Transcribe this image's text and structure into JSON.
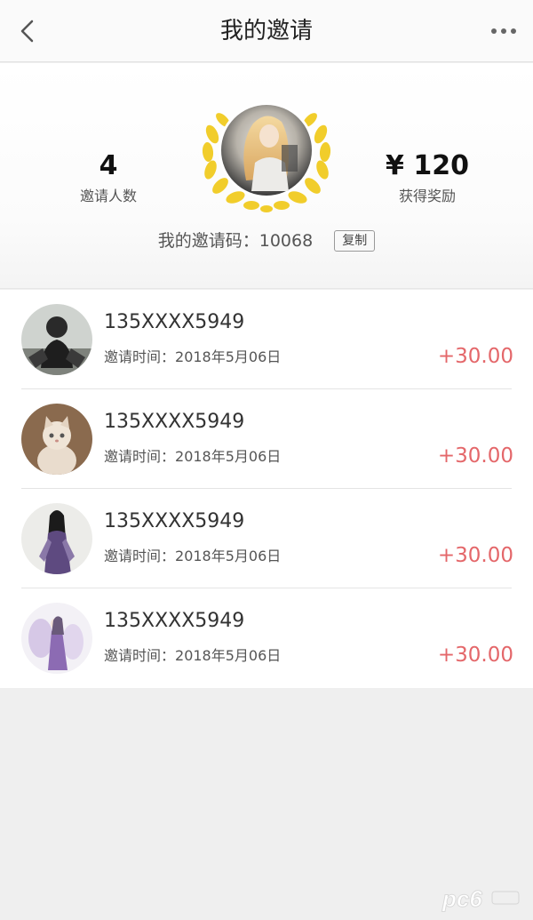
{
  "nav": {
    "title": "我的邀请",
    "back_icon": "chevron-left-icon",
    "more_icon": "more-dots-icon"
  },
  "summary": {
    "invite_count": "4",
    "invite_count_label": "邀请人数",
    "reward_value": "¥ 120",
    "reward_label": "获得奖励",
    "invite_code_label": "我的邀请码：",
    "invite_code": "10068",
    "copy_label": "复制"
  },
  "invites": [
    {
      "phone": "135XXXX5949",
      "time_label": "邀请时间：",
      "date": "2018年5月06日",
      "reward": "+30.00",
      "avatar": "masked-figure-avatar"
    },
    {
      "phone": "135XXXX5949",
      "time_label": "邀请时间：",
      "date": "2018年5月06日",
      "reward": "+30.00",
      "avatar": "kitten-avatar"
    },
    {
      "phone": "135XXXX5949",
      "time_label": "邀请时间：",
      "date": "2018年5月06日",
      "reward": "+30.00",
      "avatar": "costume-woman-avatar"
    },
    {
      "phone": "135XXXX5949",
      "time_label": "邀请时间：",
      "date": "2018年5月06日",
      "reward": "+30.00",
      "avatar": "purple-fairy-avatar"
    }
  ],
  "watermark": "pc6",
  "colors": {
    "reward_red": "#e4676a",
    "laurel_gold": "#f1cd2b",
    "page_bg": "#efefef"
  }
}
